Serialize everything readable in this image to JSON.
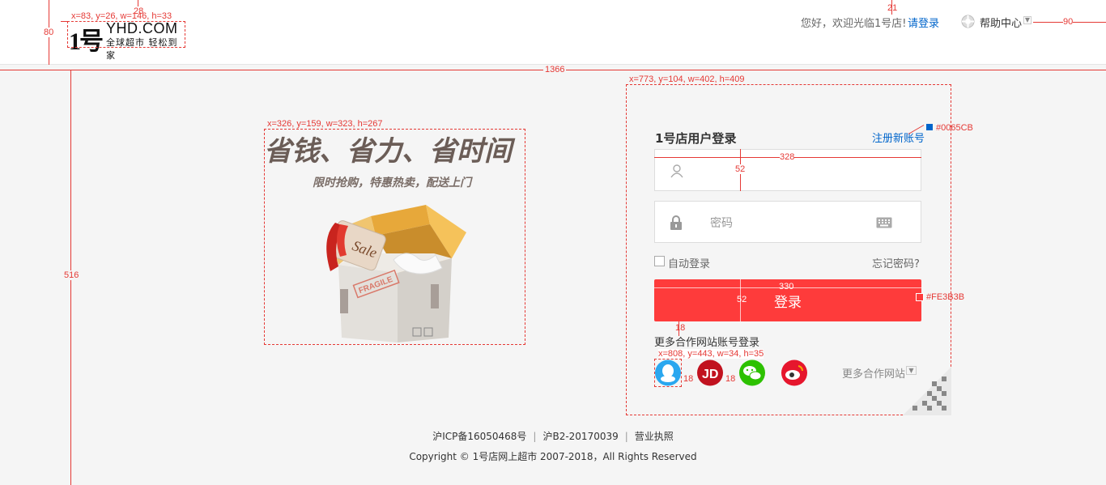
{
  "header": {
    "logo_number": "1号",
    "logo_brand": "YHD.COM",
    "logo_slogan": "全球超市 轻松到家",
    "greeting": "您好，欢迎光临1号店!",
    "login_link": "请登录",
    "help_center": "帮助中心"
  },
  "promo": {
    "title": "省钱、省力、省时间",
    "subtitle": "限时抢购，特惠热卖，配送上门",
    "sale_tag": "Sale",
    "fragile_stamp": "FRAGILE"
  },
  "login": {
    "title": "1号店用户登录",
    "register_link": "注册新账号",
    "username_placeholder": "",
    "password_placeholder": "密码",
    "remember_label": "自动登录",
    "forgot_link": "忘记密码?",
    "submit_label": "登录",
    "more_partners_label": "更多合作网站账号登录",
    "social_icons": [
      "qq-icon",
      "jd-icon",
      "wechat-icon",
      "weibo-icon"
    ],
    "more_sites_label": "更多合作网站"
  },
  "footer": {
    "icp": "沪ICP备16050468号",
    "license_b2": "沪B2-20170039",
    "business_license": "营业执照",
    "copyright": "Copyright © 1号店网上超市 2007-2018，All Rights Reserved"
  },
  "annotations": {
    "logo_box": "x=83, y=26, w=146, h=33",
    "logo_gap": "28",
    "header_height": "80",
    "top_gap": "21",
    "right_gap": "90",
    "page_width": "1366",
    "panel_box": "x=773, y=104, w=402, h=409",
    "promo_box": "x=326, y=159, w=323, h=267",
    "body_height": "516",
    "register_color": "#0065CB",
    "button_color": "#FE3B3B",
    "field_width": "328",
    "field_height": "52",
    "button_width": "330",
    "button_height": "52",
    "button_gap": "18",
    "social_box": "x=808, y=443, w=34, h=35",
    "social_gap": "18"
  },
  "colors": {
    "link_blue": "#0065CB",
    "button_red": "#FE3B3B",
    "annotation_red": "#e53935"
  }
}
